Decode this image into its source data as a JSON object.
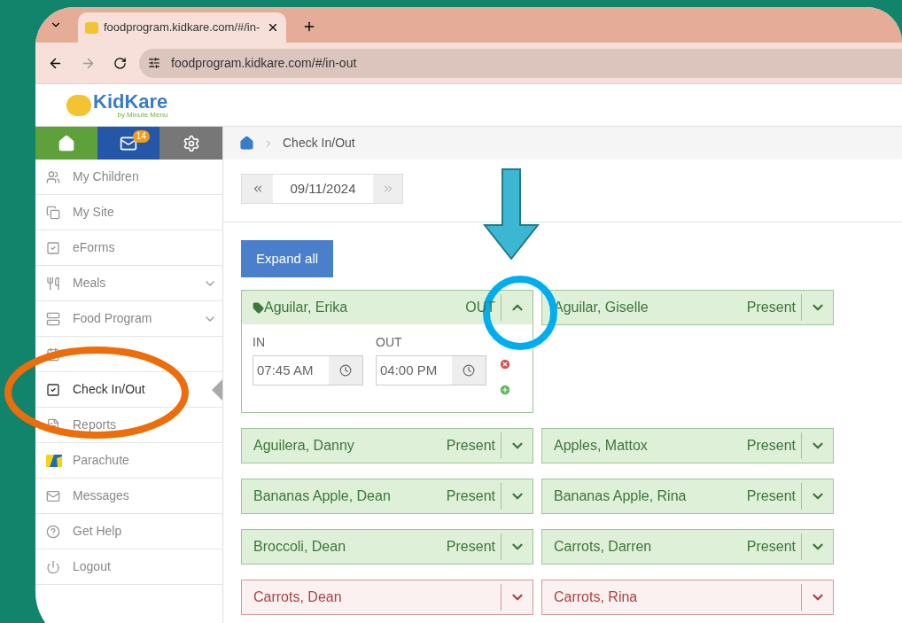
{
  "browser": {
    "tab_title": "foodprogram.kidkare.com/#/in-",
    "url": "foodprogram.kidkare.com/#/in-out"
  },
  "logo": {
    "name": "KidKare",
    "tagline": "by Minute Menu"
  },
  "nav_buttons": {
    "mail_badge": "14"
  },
  "sidebar": {
    "items": [
      {
        "label": "My Children",
        "selected": false,
        "expandable": false
      },
      {
        "label": "My Site",
        "selected": false,
        "expandable": false
      },
      {
        "label": "eForms",
        "selected": false,
        "expandable": false
      },
      {
        "label": "Meals",
        "selected": false,
        "expandable": true
      },
      {
        "label": "Food Program",
        "selected": false,
        "expandable": true
      },
      {
        "selected": false,
        "expandable": false
      },
      {
        "label": "Check In/Out",
        "selected": true,
        "expandable": false
      },
      {
        "label": "Reports",
        "selected": false,
        "expandable": false
      },
      {
        "label": "Parachute",
        "selected": false,
        "expandable": false
      },
      {
        "label": "Messages",
        "selected": false,
        "expandable": false
      },
      {
        "label": "Get Help",
        "selected": false,
        "expandable": false
      },
      {
        "label": "Logout",
        "selected": false,
        "expandable": false
      }
    ]
  },
  "breadcrumb": {
    "current": "Check In/Out"
  },
  "date_picker": {
    "date": "09/11/2024"
  },
  "expand_all_button": "Expand all",
  "children": [
    {
      "name": "Aguilar, Erika",
      "status": "OUT",
      "kind": "present",
      "tagged": true,
      "expanded": true,
      "in_label": "IN",
      "in_time": "07:45 AM",
      "out_label": "OUT",
      "out_time": "04:00 PM"
    },
    {
      "name": "Aguilar, Giselle",
      "status": "Present",
      "kind": "present",
      "tagged": false,
      "expanded": false
    },
    {
      "name": "Aguilera, Danny",
      "status": "Present",
      "kind": "present",
      "tagged": false,
      "expanded": false
    },
    {
      "name": "Apples, Mattox",
      "status": "Present",
      "kind": "present",
      "tagged": false,
      "expanded": false
    },
    {
      "name": "Bananas Apple, Dean",
      "status": "Present",
      "kind": "present",
      "tagged": false,
      "expanded": false
    },
    {
      "name": "Bananas Apple, Rina",
      "status": "Present",
      "kind": "present",
      "tagged": false,
      "expanded": false
    },
    {
      "name": "Broccoli, Dean",
      "status": "Present",
      "kind": "present",
      "tagged": false,
      "expanded": false
    },
    {
      "name": "Carrots, Darren",
      "status": "Present",
      "kind": "present",
      "tagged": false,
      "expanded": false
    },
    {
      "name": "Carrots, Dean",
      "kind": "absent",
      "tagged": false,
      "expanded": false
    },
    {
      "name": "Carrots, Rina",
      "kind": "absent",
      "tagged": false,
      "expanded": false
    }
  ]
}
